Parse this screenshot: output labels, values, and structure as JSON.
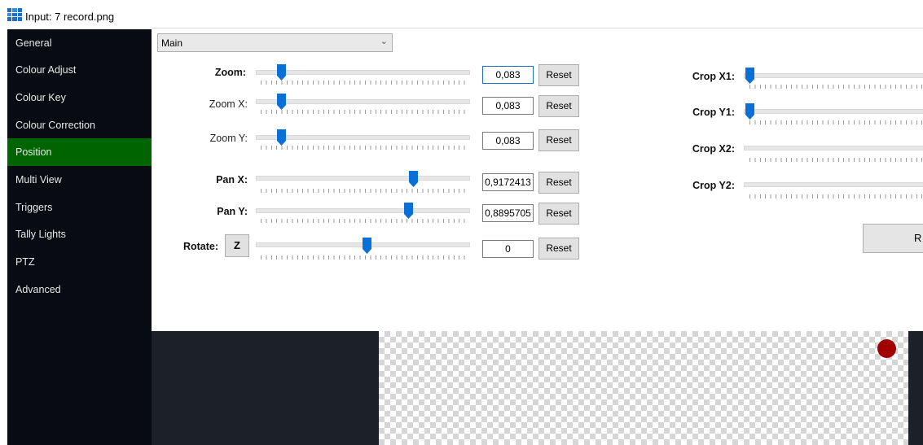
{
  "window": {
    "title": "Input: 7 record.png",
    "icon": "grid-app-icon"
  },
  "sidebar": {
    "items": [
      {
        "label": "General",
        "active": false
      },
      {
        "label": "Colour Adjust",
        "active": false
      },
      {
        "label": "Colour Key",
        "active": false
      },
      {
        "label": "Colour Correction",
        "active": false
      },
      {
        "label": "Position",
        "active": true
      },
      {
        "label": "Multi View",
        "active": false
      },
      {
        "label": "Triggers",
        "active": false
      },
      {
        "label": "Tally Lights",
        "active": false
      },
      {
        "label": "PTZ",
        "active": false
      },
      {
        "label": "Advanced",
        "active": false
      }
    ],
    "active_color": "#006400"
  },
  "layer_select": {
    "value": "Main"
  },
  "controls": {
    "zoom": {
      "label": "Zoom:",
      "value": "0,083",
      "reset": "Reset",
      "level": 0.083
    },
    "zoom_x": {
      "label": "Zoom X:",
      "value": "0,083",
      "reset": "Reset",
      "level": 0.083
    },
    "zoom_y": {
      "label": "Zoom Y:",
      "value": "0,083",
      "reset": "Reset",
      "level": 0.083
    },
    "pan_x": {
      "label": "Pan X:",
      "value": "0,9172413",
      "reset": "Reset",
      "level": 0.9172413
    },
    "pan_y": {
      "label": "Pan Y:",
      "value": "0,8895705",
      "reset": "Reset",
      "level": 0.8895705
    },
    "rotate": {
      "label": "Rotate:",
      "axis_button": "Z",
      "value": "0",
      "reset": "Reset",
      "level": 0.5
    }
  },
  "crop": {
    "x1": {
      "label": "Crop X1:"
    },
    "y1": {
      "label": "Crop Y1:"
    },
    "x2": {
      "label": "Crop X2:"
    },
    "y2": {
      "label": "Crop Y2:"
    },
    "button_label_visible": "R"
  },
  "preview": {
    "dot_color": "#a00000",
    "background": "#1c2129"
  }
}
